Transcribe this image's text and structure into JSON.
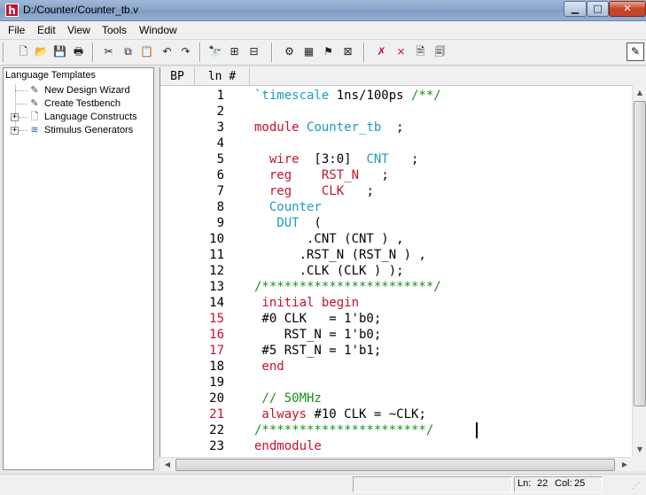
{
  "window": {
    "title": "D:/Counter/Counter_tb.v",
    "app_icon_letter": "h",
    "minimize_glyph": "▁",
    "maximize_glyph": "□",
    "close_glyph": "✕"
  },
  "menu": {
    "items": [
      {
        "label": "File"
      },
      {
        "label": "Edit"
      },
      {
        "label": "View"
      },
      {
        "label": "Tools"
      },
      {
        "label": "Window"
      }
    ]
  },
  "toolbar": {
    "buttons": [
      {
        "icon": "new-file-icon",
        "glyph": "🗋"
      },
      {
        "icon": "open-folder-icon",
        "glyph": "📂"
      },
      {
        "icon": "save-icon",
        "glyph": "💾"
      },
      {
        "icon": "print-icon",
        "glyph": "🖶"
      },
      {
        "icon": "cut-icon",
        "glyph": "✂"
      },
      {
        "icon": "copy-icon",
        "glyph": "⧉"
      },
      {
        "icon": "paste-icon",
        "glyph": "📋"
      },
      {
        "icon": "undo-icon",
        "glyph": "↶"
      },
      {
        "icon": "redo-icon",
        "glyph": "↷"
      },
      {
        "icon": "find-icon",
        "glyph": "🔭"
      },
      {
        "icon": "tree-icon",
        "glyph": "⊞"
      },
      {
        "icon": "hierarchy-icon",
        "glyph": "⊟"
      },
      {
        "icon": "compile-icon",
        "glyph": "⚙"
      },
      {
        "icon": "grid-icon",
        "glyph": "▦"
      },
      {
        "icon": "run-icon",
        "glyph": "⚑"
      },
      {
        "icon": "stop-icon",
        "glyph": "⊠"
      },
      {
        "icon": "delete-icon",
        "glyph": "✗"
      },
      {
        "icon": "delete-all-icon",
        "glyph": "⨯"
      },
      {
        "icon": "document-icon",
        "glyph": "🗎"
      },
      {
        "icon": "notes-icon",
        "glyph": "🗐"
      }
    ],
    "corner_glyph": "✎"
  },
  "left_panel": {
    "title": "Language Templates",
    "items": [
      {
        "label": "New Design Wizard",
        "expandable": false,
        "icon": "wizard-icon",
        "glyph": "✎"
      },
      {
        "label": "Create Testbench",
        "expandable": false,
        "icon": "testbench-icon",
        "glyph": "✎"
      },
      {
        "label": "Language Constructs",
        "expandable": true,
        "icon": "document-icon",
        "glyph": "🗋"
      },
      {
        "label": "Stimulus Generators",
        "expandable": true,
        "icon": "waveform-icon",
        "glyph": "≋"
      }
    ],
    "expander_glyph": "+"
  },
  "editor": {
    "header": {
      "bp": "BP",
      "ln": "ln #"
    },
    "lines": [
      {
        "n": "1",
        "red": false,
        "parts": [
          {
            "t": "`timescale",
            "c": "id"
          },
          {
            "t": " 1ns/100ps ",
            "c": "tx"
          },
          {
            "t": "/**/",
            "c": "cm"
          }
        ],
        "indent": 0
      },
      {
        "n": "2",
        "red": false,
        "parts": [],
        "indent": 0
      },
      {
        "n": "3",
        "red": false,
        "parts": [
          {
            "t": "module",
            "c": "kw"
          },
          {
            "t": " ",
            "c": "tx"
          },
          {
            "t": "Counter_tb",
            "c": "id"
          },
          {
            "t": "  ;",
            "c": "tx"
          }
        ],
        "indent": 0
      },
      {
        "n": "4",
        "red": false,
        "parts": [],
        "indent": 0
      },
      {
        "n": "5",
        "red": false,
        "parts": [
          {
            "t": "  wire",
            "c": "kw"
          },
          {
            "t": "  [3:0]  ",
            "c": "tx"
          },
          {
            "t": "CNT",
            "c": "id"
          },
          {
            "t": "   ;",
            "c": "tx"
          }
        ],
        "indent": 0
      },
      {
        "n": "6",
        "red": false,
        "parts": [
          {
            "t": "  reg",
            "c": "kw"
          },
          {
            "t": "    ",
            "c": "tx"
          },
          {
            "t": "RST_N",
            "c": "kw"
          },
          {
            "t": "   ;",
            "c": "tx"
          }
        ],
        "indent": 0
      },
      {
        "n": "7",
        "red": false,
        "parts": [
          {
            "t": "  reg",
            "c": "kw"
          },
          {
            "t": "    ",
            "c": "tx"
          },
          {
            "t": "CLK",
            "c": "kw"
          },
          {
            "t": "   ;",
            "c": "tx"
          }
        ],
        "indent": 0
      },
      {
        "n": "8",
        "red": false,
        "parts": [
          {
            "t": "  Counter",
            "c": "id"
          }
        ],
        "indent": 0
      },
      {
        "n": "9",
        "red": false,
        "parts": [
          {
            "t": "   DUT",
            "c": "id"
          },
          {
            "t": "  (",
            "c": "tx"
          }
        ],
        "indent": 0
      },
      {
        "n": "10",
        "red": false,
        "parts": [
          {
            "t": "       .CNT (CNT ) ,",
            "c": "tx"
          }
        ],
        "indent": 0
      },
      {
        "n": "11",
        "red": false,
        "parts": [
          {
            "t": "      .RST_N (RST_N ) ,",
            "c": "tx"
          }
        ],
        "indent": 0
      },
      {
        "n": "12",
        "red": false,
        "parts": [
          {
            "t": "      .CLK (CLK ) );",
            "c": "tx"
          }
        ],
        "indent": 0
      },
      {
        "n": "13",
        "red": false,
        "parts": [
          {
            "t": "/***********************/",
            "c": "cm"
          }
        ],
        "indent": 0
      },
      {
        "n": "14",
        "red": false,
        "parts": [
          {
            "t": " initial begin",
            "c": "kw"
          }
        ],
        "indent": 0
      },
      {
        "n": "15",
        "red": true,
        "parts": [
          {
            "t": " #0 CLK   = 1'b0;",
            "c": "tx"
          }
        ],
        "indent": 0
      },
      {
        "n": "16",
        "red": true,
        "parts": [
          {
            "t": "    RST_N = 1'b0;",
            "c": "tx"
          }
        ],
        "indent": 0
      },
      {
        "n": "17",
        "red": true,
        "parts": [
          {
            "t": " #5 RST_N = 1'b1;",
            "c": "tx"
          }
        ],
        "indent": 0
      },
      {
        "n": "18",
        "red": false,
        "parts": [
          {
            "t": " end",
            "c": "kw"
          }
        ],
        "indent": 0
      },
      {
        "n": "19",
        "red": false,
        "parts": [],
        "indent": 0
      },
      {
        "n": "20",
        "red": false,
        "parts": [
          {
            "t": " // 50MHz",
            "c": "cm"
          }
        ],
        "indent": 0
      },
      {
        "n": "21",
        "red": true,
        "parts": [
          {
            "t": " always",
            "c": "kw"
          },
          {
            "t": " #10 CLK = ~CLK;",
            "c": "tx"
          }
        ],
        "indent": 0
      },
      {
        "n": "22",
        "red": false,
        "parts": [
          {
            "t": "/**********************/",
            "c": "cm"
          }
        ],
        "indent": 0
      },
      {
        "n": "23",
        "red": false,
        "parts": [
          {
            "t": "endmodule",
            "c": "kw"
          }
        ],
        "indent": 0
      }
    ]
  },
  "scrollbars": {
    "up_glyph": "▲",
    "down_glyph": "▼",
    "left_glyph": "◀",
    "right_glyph": "▶"
  },
  "status": {
    "ln_label": "Ln:",
    "ln_value": "22",
    "col_label": "Col:",
    "col_value": "25",
    "grip_glyph": "⋰"
  },
  "colors": {
    "keyword": "#c8102e",
    "identifier": "#1b9cbf",
    "comment": "#1a8f1a",
    "line_number_highlight": "#c8102e"
  }
}
